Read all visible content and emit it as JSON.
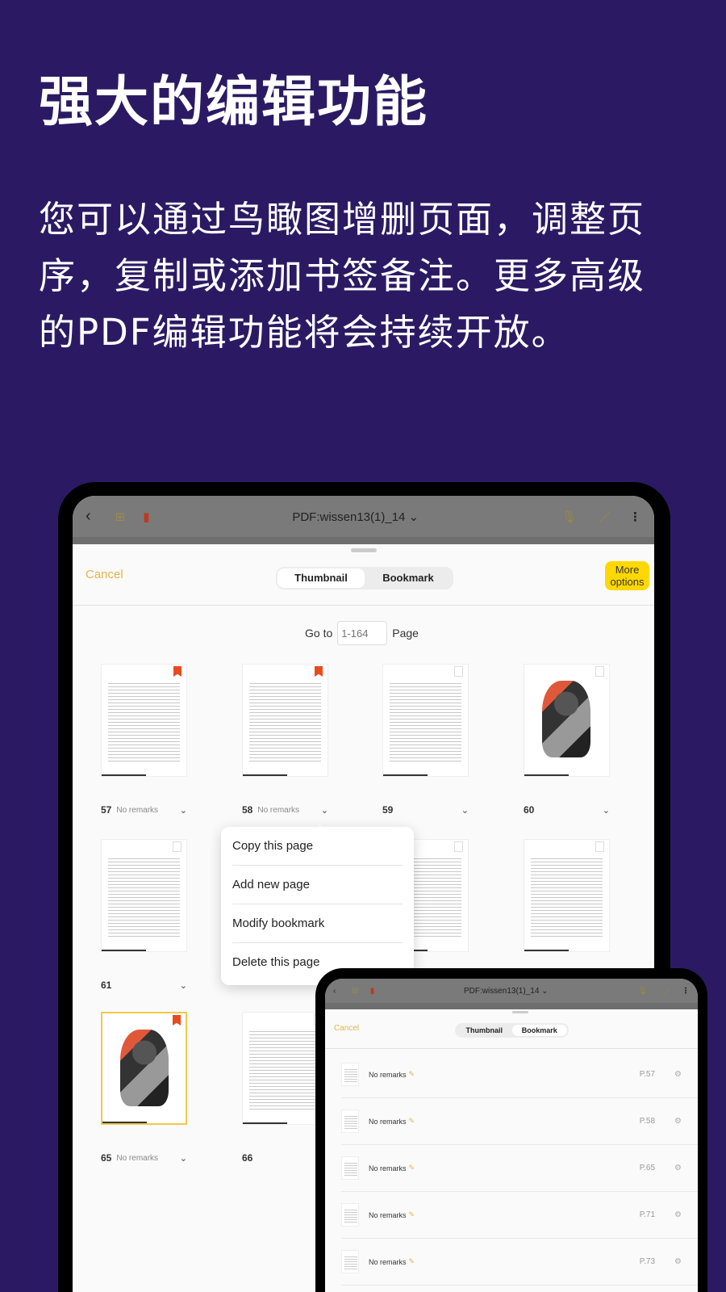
{
  "headline": "强大的编辑功能",
  "description": "您可以通过鸟瞰图增删页面，调整页序，复制或添加书签备注。更多高级的PDF编辑功能将会持续开放。",
  "tablet": {
    "doc_title": "PDF:wissen13(1)_14",
    "cancel": "Cancel",
    "tabs": [
      "Thumbnail",
      "Bookmark"
    ],
    "active_tab": "Thumbnail",
    "more_options": "More options",
    "goto_label": "Go to",
    "goto_placeholder": "1-164",
    "page_label": "Page",
    "thumbnails": [
      {
        "page": "57",
        "remark": "No remarks",
        "bookmarked": true,
        "kind": "text"
      },
      {
        "page": "58",
        "remark": "No remarks",
        "bookmarked": true,
        "kind": "text"
      },
      {
        "page": "59",
        "remark": "",
        "bookmarked": false,
        "kind": "text"
      },
      {
        "page": "60",
        "remark": "",
        "bookmarked": false,
        "kind": "image"
      },
      {
        "page": "61",
        "remark": "",
        "bookmarked": false,
        "kind": "text"
      },
      {
        "page": "",
        "remark": "",
        "bookmarked": false,
        "kind": "hidden"
      },
      {
        "page": "",
        "remark": "",
        "bookmarked": false,
        "kind": "text"
      },
      {
        "page": "",
        "remark": "",
        "bookmarked": false,
        "kind": "text"
      },
      {
        "page": "65",
        "remark": "No remarks",
        "bookmarked": true,
        "kind": "image",
        "selected": true
      },
      {
        "page": "66",
        "remark": "",
        "bookmarked": false,
        "kind": "text"
      },
      {
        "page": "",
        "remark": "",
        "bookmarked": false,
        "kind": "text"
      },
      {
        "page": "",
        "remark": "",
        "bookmarked": false,
        "kind": "text"
      }
    ],
    "context_menu": [
      "Copy this page",
      "Add new page",
      "Modify bookmark",
      "Delete this page"
    ]
  },
  "phone": {
    "doc_title": "PDF:wissen13(1)_14",
    "cancel": "Cancel",
    "tabs": [
      "Thumbnail",
      "Bookmark"
    ],
    "active_tab": "Bookmark",
    "bookmarks": [
      {
        "remark": "No remarks",
        "page": "P.57"
      },
      {
        "remark": "No remarks",
        "page": "P.58"
      },
      {
        "remark": "No remarks",
        "page": "P.65"
      },
      {
        "remark": "No remarks",
        "page": "P.71"
      },
      {
        "remark": "No remarks",
        "page": "P.73"
      }
    ]
  },
  "colors": {
    "background": "#2b1a63",
    "accent": "#e0b64a",
    "bookmark": "#e84b1d",
    "more_button": "#ffd800"
  }
}
